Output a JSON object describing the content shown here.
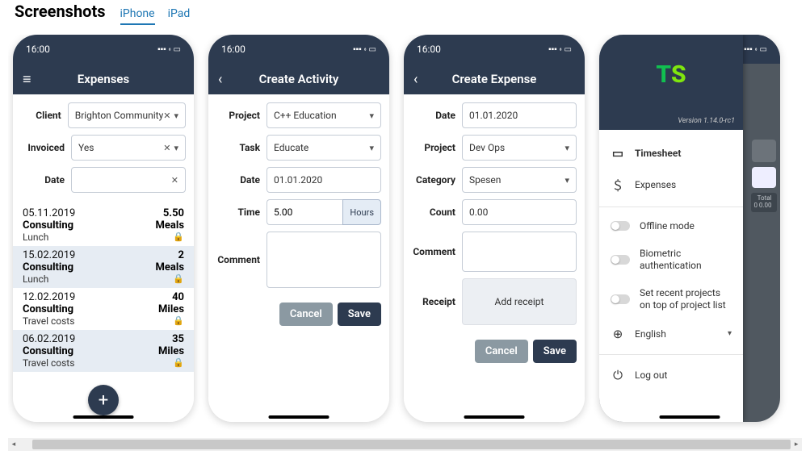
{
  "header": {
    "title": "Screenshots"
  },
  "tabs": {
    "iphone": "iPhone",
    "ipad": "iPad"
  },
  "statusbar": {
    "time": "16:00"
  },
  "s1": {
    "title": "Expenses",
    "fields": {
      "client_label": "Client",
      "client_value": "Brighton Community",
      "invoiced_label": "Invoiced",
      "invoiced_value": "Yes",
      "date_label": "Date",
      "date_value": ""
    },
    "items": [
      {
        "date": "05.11.2019",
        "amt": "5.50",
        "project": "Consulting",
        "cat": "Meals",
        "desc": "Lunch"
      },
      {
        "date": "15.02.2019",
        "amt": "2",
        "project": "Consulting",
        "cat": "Meals",
        "desc": "Lunch"
      },
      {
        "date": "12.02.2019",
        "amt": "40",
        "project": "Consulting",
        "cat": "Miles",
        "desc": "Travel costs"
      },
      {
        "date": "06.02.2019",
        "amt": "35",
        "project": "Consulting",
        "cat": "Miles",
        "desc": "Travel costs"
      }
    ]
  },
  "s2": {
    "title": "Create Activity",
    "project_label": "Project",
    "project_value": "C++ Education",
    "task_label": "Task",
    "task_value": "Educate",
    "date_label": "Date",
    "date_value": "01.01.2020",
    "time_label": "Time",
    "time_value": "5.00",
    "time_unit": "Hours",
    "comment_label": "Comment",
    "cancel": "Cancel",
    "save": "Save"
  },
  "s3": {
    "title": "Create Expense",
    "date_label": "Date",
    "date_value": "01.01.2020",
    "project_label": "Project",
    "project_value": "Dev Ops",
    "category_label": "Category",
    "category_value": "Spesen",
    "count_label": "Count",
    "count_value": "0.00",
    "comment_label": "Comment",
    "receipt_label": "Receipt",
    "add_receipt": "Add receipt",
    "cancel": "Cancel",
    "save": "Save"
  },
  "s4": {
    "logo_t": "T",
    "logo_s": "S",
    "version": "Version 1.14.0-rc1",
    "timesheet": "Timesheet",
    "expenses": "Expenses",
    "offline": "Offline mode",
    "biometric": "Biometric authentication",
    "recent": "Set recent projects on top of project list",
    "language": "English",
    "logout": "Log out",
    "bg_total": " Total",
    "bg_amount": "0 0.00"
  }
}
